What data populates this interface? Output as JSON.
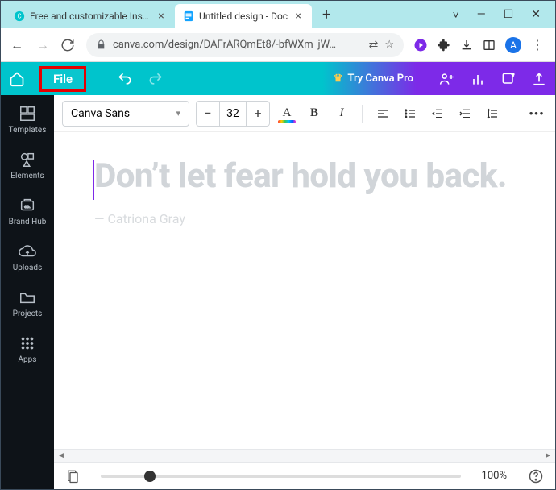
{
  "browser": {
    "tabs": [
      {
        "title": "Free and customizable Instag",
        "favicon": "canva"
      },
      {
        "title": "Untitled design - Doc",
        "favicon": "doc"
      }
    ],
    "active_tab": 1,
    "url": "canva.com/design/DAFrARQmEt8/-bfWXm_jW…",
    "avatar_initial": "A"
  },
  "app": {
    "file_menu_label": "File",
    "try_label": "Try Canva Pro"
  },
  "sidebar": {
    "items": [
      {
        "label": "Templates",
        "icon": "grid"
      },
      {
        "label": "Elements",
        "icon": "shapes"
      },
      {
        "label": "Brand Hub",
        "icon": "brand"
      },
      {
        "label": "Uploads",
        "icon": "cloud"
      },
      {
        "label": "Projects",
        "icon": "folder"
      },
      {
        "label": "Apps",
        "icon": "apps"
      }
    ]
  },
  "format_bar": {
    "font_name": "Canva Sans",
    "font_size": "32",
    "color_letter": "A",
    "bold_letter": "B",
    "italic_letter": "I",
    "minus": "−",
    "plus": "+",
    "more": "•••"
  },
  "document": {
    "quote": "Don’t let fear hold you back.",
    "attribution": "— Catriona Gray"
  },
  "footer": {
    "zoom_label": "100%"
  }
}
